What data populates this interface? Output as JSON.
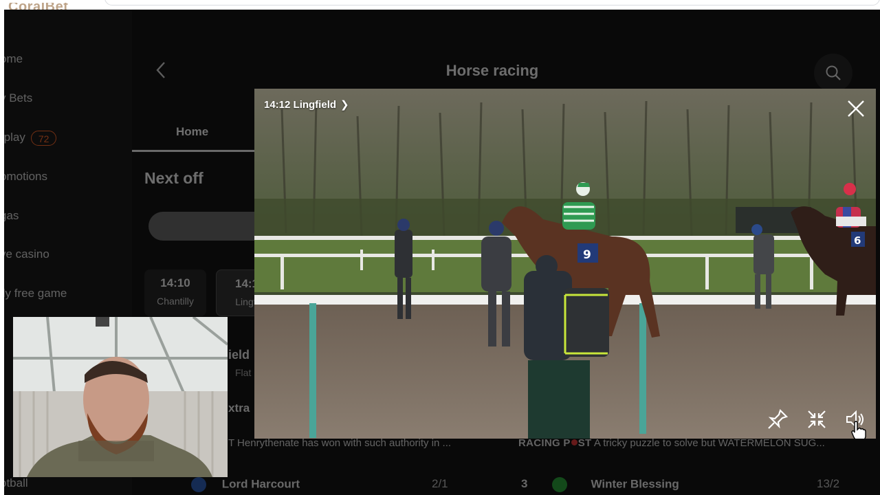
{
  "brand": {
    "text": "CoralBet"
  },
  "sidebar": {
    "items": [
      {
        "label": "ome"
      },
      {
        "label": "y Bets"
      },
      {
        "label": "-play",
        "badge": "72"
      },
      {
        "label": "omotions"
      },
      {
        "label": "gas"
      },
      {
        "label": "ve casino"
      },
      {
        "label": "ily free game"
      }
    ],
    "football": "otball"
  },
  "header": {
    "title": "Horse racing"
  },
  "tabs": {
    "home": "Home"
  },
  "next_off": {
    "heading": "Next off",
    "races": [
      {
        "time": "14:10",
        "venue": "Chantilly"
      },
      {
        "time": "14:1",
        "venue": "Lingfi"
      }
    ],
    "race_fragment": "ield",
    "race_fragment_sub": "Flat",
    "extra_fragment": "xtra"
  },
  "news": [
    {
      "source": "",
      "text": "T Henrythenate has won with such authority in ..."
    },
    {
      "source_a": "RACING P",
      "source_b": "ST",
      "text": "A tricky puzzle to solve but WATERMELON SUG..."
    }
  ],
  "runners": [
    {
      "number": "",
      "name": "Lord Harcourt",
      "odds": "2/1"
    },
    {
      "number": "3",
      "name": "Winter Blessing",
      "odds": "13/2"
    }
  ],
  "player": {
    "title": "14:12 Lingfield",
    "saddle_left": "9",
    "saddle_right": "6",
    "buttons": {
      "pin": "pin-icon",
      "minimize": "minimize-icon",
      "volume": "volume-icon",
      "close": "close-icon"
    }
  },
  "colors": {
    "accent": "#ff6a2c",
    "bg": "#121212"
  }
}
